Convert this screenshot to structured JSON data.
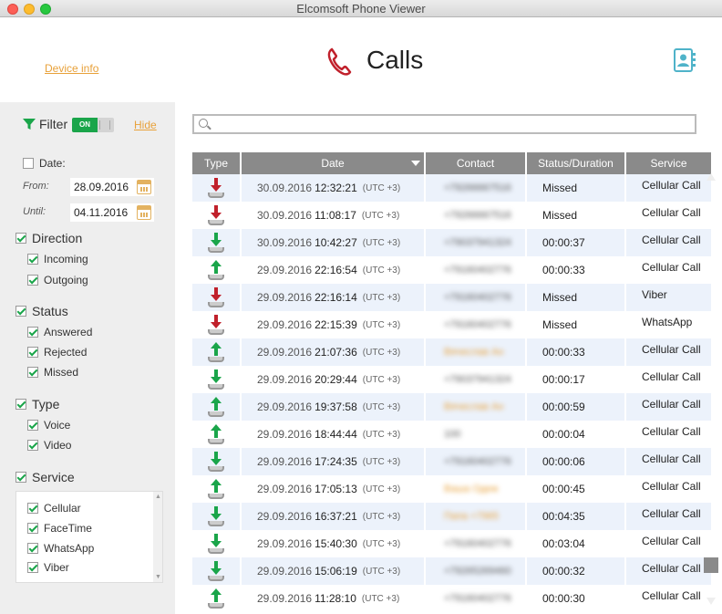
{
  "window": {
    "title": "Elcomsoft Phone Viewer"
  },
  "header": {
    "device_info": "Device info",
    "title": "Calls"
  },
  "filter": {
    "label": "Filter",
    "toggle": "ON",
    "hide": "Hide",
    "date": {
      "label": "Date:",
      "checked": false,
      "from_label": "From:",
      "from_value": "28.09.2016",
      "until_label": "Until:",
      "until_value": "04.11.2016"
    },
    "direction": {
      "label": "Direction",
      "incoming": "Incoming",
      "outgoing": "Outgoing"
    },
    "status": {
      "label": "Status",
      "answered": "Answered",
      "rejected": "Rejected",
      "missed": "Missed"
    },
    "type": {
      "label": "Type",
      "voice": "Voice",
      "video": "Video"
    },
    "service": {
      "label": "Service",
      "items": [
        "Cellular",
        "FaceTime",
        "WhatsApp",
        "Viber"
      ]
    }
  },
  "search": {
    "placeholder": ""
  },
  "table": {
    "columns": [
      "Type",
      "Date",
      "Contact",
      "Status/Duration",
      "Service"
    ],
    "rows": [
      {
        "type": "missed-icon",
        "date": "30.09.2016",
        "time": "12:32:21",
        "tz": "(UTC +3)",
        "contact": "+79266667516",
        "contact_orange": false,
        "status": "Missed",
        "service": "Cellular Call"
      },
      {
        "type": "missed-icon",
        "date": "30.09.2016",
        "time": "11:08:17",
        "tz": "(UTC +3)",
        "contact": "+79266667516",
        "contact_orange": false,
        "status": "Missed",
        "service": "Cellular Call"
      },
      {
        "type": "incoming-icon",
        "date": "30.09.2016",
        "time": "10:42:27",
        "tz": "(UTC +3)",
        "contact": "+79037941324",
        "contact_orange": false,
        "status": "00:00:37",
        "service": "Cellular Call"
      },
      {
        "type": "outgoing-icon",
        "date": "29.09.2016",
        "time": "22:16:54",
        "tz": "(UTC +3)",
        "contact": "+79160402776",
        "contact_orange": false,
        "status": "00:00:33",
        "service": "Cellular Call"
      },
      {
        "type": "missed-icon",
        "date": "29.09.2016",
        "time": "22:16:14",
        "tz": "(UTC +3)",
        "contact": "+79160402776",
        "contact_orange": false,
        "status": "Missed",
        "service": "Viber"
      },
      {
        "type": "missed-icon",
        "date": "29.09.2016",
        "time": "22:15:39",
        "tz": "(UTC +3)",
        "contact": "+79160402776",
        "contact_orange": false,
        "status": "Missed",
        "service": "WhatsApp"
      },
      {
        "type": "outgoing-icon",
        "date": "29.09.2016",
        "time": "21:07:36",
        "tz": "(UTC +3)",
        "contact": "Вячеслав Ан",
        "contact_orange": true,
        "status": "00:00:33",
        "service": "Cellular Call"
      },
      {
        "type": "incoming-icon",
        "date": "29.09.2016",
        "time": "20:29:44",
        "tz": "(UTC +3)",
        "contact": "+79037941324",
        "contact_orange": false,
        "status": "00:00:17",
        "service": "Cellular Call"
      },
      {
        "type": "outgoing-icon",
        "date": "29.09.2016",
        "time": "19:37:58",
        "tz": "(UTC +3)",
        "contact": "Вячеслав Ан",
        "contact_orange": true,
        "status": "00:00:59",
        "service": "Cellular Call"
      },
      {
        "type": "outgoing-icon",
        "date": "29.09.2016",
        "time": "18:44:44",
        "tz": "(UTC +3)",
        "contact": "100",
        "contact_orange": false,
        "status": "00:00:04",
        "service": "Cellular Call"
      },
      {
        "type": "incoming-icon",
        "date": "29.09.2016",
        "time": "17:24:35",
        "tz": "(UTC +3)",
        "contact": "+79160402776",
        "contact_orange": false,
        "status": "00:00:06",
        "service": "Cellular Call"
      },
      {
        "type": "outgoing-icon",
        "date": "29.09.2016",
        "time": "17:05:13",
        "tz": "(UTC +3)",
        "contact": "Ваша Одеж",
        "contact_orange": true,
        "status": "00:00:45",
        "service": "Cellular Call"
      },
      {
        "type": "incoming-icon",
        "date": "29.09.2016",
        "time": "16:37:21",
        "tz": "(UTC +3)",
        "contact": "Папа +7965",
        "contact_orange": true,
        "status": "00:04:35",
        "service": "Cellular Call"
      },
      {
        "type": "incoming-icon",
        "date": "29.09.2016",
        "time": "15:40:30",
        "tz": "(UTC +3)",
        "contact": "+79160402776",
        "contact_orange": false,
        "status": "00:03:04",
        "service": "Cellular Call"
      },
      {
        "type": "incoming-icon",
        "date": "29.09.2016",
        "time": "15:06:19",
        "tz": "(UTC +3)",
        "contact": "+79265269460",
        "contact_orange": false,
        "status": "00:00:32",
        "service": "Cellular Call"
      },
      {
        "type": "outgoing-icon",
        "date": "29.09.2016",
        "time": "11:28:10",
        "tz": "(UTC +3)",
        "contact": "+79160402776",
        "contact_orange": false,
        "status": "00:00:30",
        "service": "Cellular Call"
      }
    ]
  },
  "colors": {
    "accent_orange": "#e8a13a",
    "green": "#1aa54a",
    "red": "#c0202b",
    "header_gray": "#8a8a8a"
  }
}
